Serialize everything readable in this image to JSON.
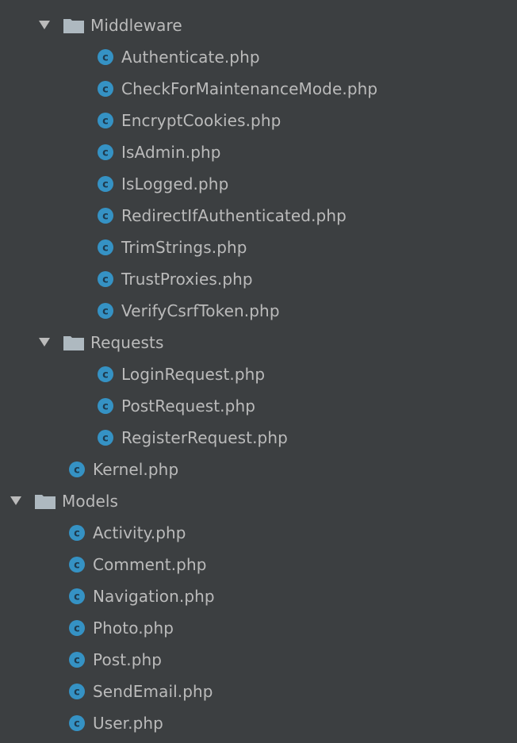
{
  "project_tree": {
    "middleware": {
      "label": "Middleware",
      "files": [
        "Authenticate.php",
        "CheckForMaintenanceMode.php",
        "EncryptCookies.php",
        "IsAdmin.php",
        "IsLogged.php",
        "RedirectIfAuthenticated.php",
        "TrimStrings.php",
        "TrustProxies.php",
        "VerifyCsrfToken.php"
      ]
    },
    "requests": {
      "label": "Requests",
      "files": [
        "LoginRequest.php",
        "PostRequest.php",
        "RegisterRequest.php"
      ]
    },
    "kernel": "Kernel.php",
    "models": {
      "label": "Models",
      "files": [
        "Activity.php",
        "Comment.php",
        "Navigation.php",
        "Photo.php",
        "Post.php",
        "SendEmail.php",
        "User.php"
      ]
    }
  },
  "icons": {
    "folder": "folder-icon",
    "class": "php-class-icon",
    "expanded": "triangle-down-icon"
  },
  "colors": {
    "background": "#3c3f41",
    "text": "#bbbbbb",
    "class_icon": "#3592c4",
    "folder": "#aeb9c0"
  }
}
